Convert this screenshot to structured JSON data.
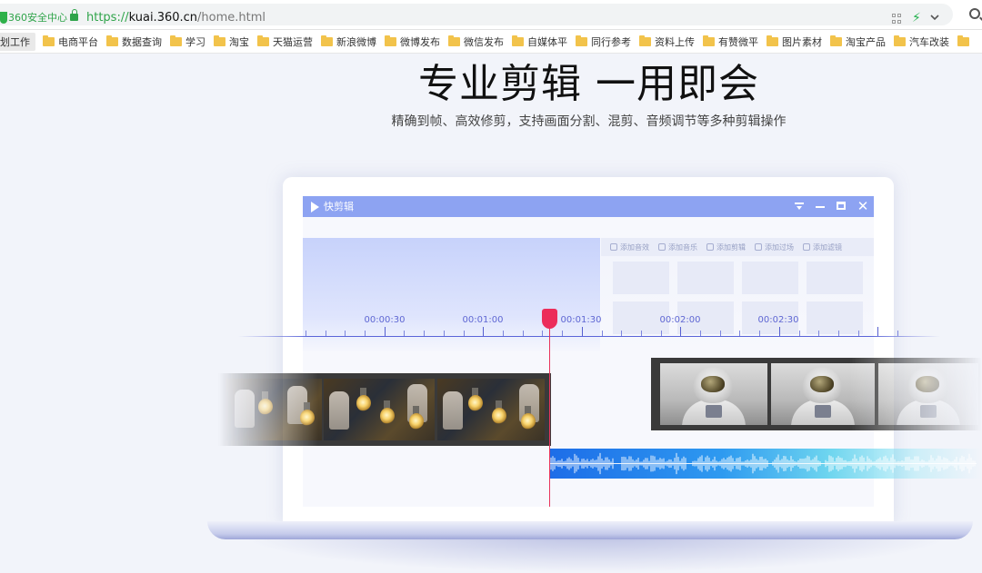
{
  "browser": {
    "security_label": "360安全中心",
    "url_protocol": "https://",
    "url_host": "kuai.360.cn",
    "url_path": "/home.html",
    "accent_color": "#2fa44a"
  },
  "bookmarks": [
    "划工作",
    "电商平台",
    "数据查询",
    "学习",
    "淘宝",
    "天猫运营",
    "新浪微博",
    "微博发布",
    "微信发布",
    "自媒体平",
    "同行参考",
    "资料上传",
    "有赞微平",
    "图片素材",
    "淘宝产品",
    "汽车改装"
  ],
  "hero": {
    "title": "专业剪辑 一用即会",
    "subtitle": "精确到帧、高效修剪，支持画面分割、混剪、音频调节等多种剪辑操作"
  },
  "app": {
    "title": "快剪辑",
    "titlebar_color": "#8da3f2",
    "tabs": [
      "添加音效",
      "添加音乐",
      "添加剪辑",
      "添加过场",
      "添加滤镜"
    ],
    "timecodes": [
      "00:00:30",
      "00:01:00",
      "00:01:30",
      "00:02:00",
      "00:02:30"
    ],
    "playhead_color": "#ec2d5a"
  }
}
